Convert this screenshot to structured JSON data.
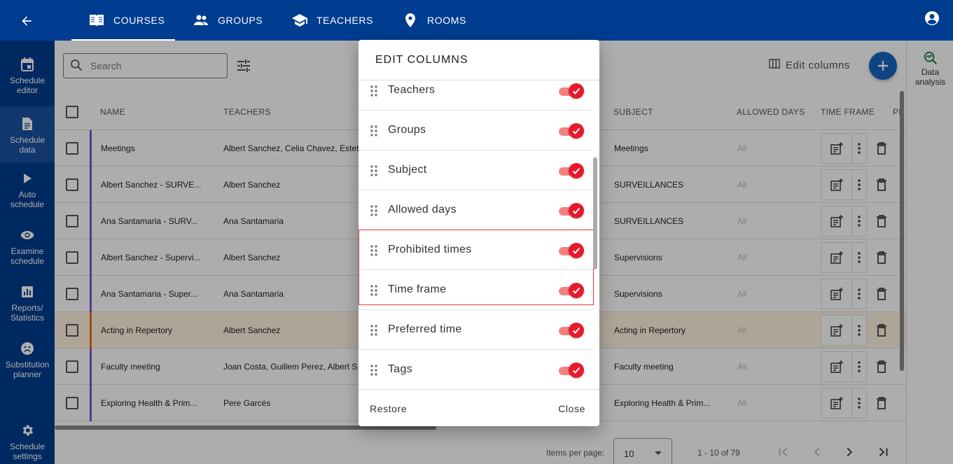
{
  "topbar": {
    "tabs": [
      {
        "label": "COURSES",
        "icon": "book-icon"
      },
      {
        "label": "GROUPS",
        "icon": "people-icon"
      },
      {
        "label": "TEACHERS",
        "icon": "school-icon"
      },
      {
        "label": "ROOMS",
        "icon": "location-pin-icon"
      }
    ],
    "active_tab": "COURSES"
  },
  "sidebar": {
    "items": [
      {
        "label": "Schedule editor",
        "line1": "Schedule",
        "line2": "editor"
      },
      {
        "label": "Schedule data",
        "line1": "Schedule",
        "line2": "data",
        "active": true
      },
      {
        "label": "Auto schedule",
        "line1": "Auto",
        "line2": "schedule"
      },
      {
        "label": "Examine schedule",
        "line1": "Examine",
        "line2": "schedule"
      },
      {
        "label": "Reports/ Statistics",
        "line1": "Reports/",
        "line2": "Statistics"
      },
      {
        "label": "Substitution planner",
        "line1": "Substitution",
        "line2": "planner"
      },
      {
        "label": "Schedule settings",
        "line1": "Schedule",
        "line2": "settings"
      }
    ]
  },
  "toolbar": {
    "search_placeholder": "Search",
    "edit_columns_label": "Edit columns"
  },
  "table": {
    "headers": {
      "name": "NAME",
      "teachers": "TEACHERS",
      "subject": "SUBJECT",
      "allowed_days": "ALLOWED DAYS",
      "time_frame": "TIME FRAME",
      "pr": "PI"
    },
    "rows": [
      {
        "name": "Meetings",
        "teachers": "Albert Sanchez, Celia Chavez, Estet",
        "subject": "Meetings",
        "allowed_days": "All"
      },
      {
        "name": "Albert Sanchez - SURVE...",
        "teachers": "Albert Sanchez",
        "subject": "SURVEILLANCES",
        "allowed_days": "All"
      },
      {
        "name": "Ana Santamaria - SURV...",
        "teachers": "Ana Santamaria",
        "subject": "SURVEILLANCES",
        "allowed_days": "All"
      },
      {
        "name": "Albert Sanchez - Supervi...",
        "teachers": "Albert Sanchez",
        "subject": "Supervisions",
        "allowed_days": "All"
      },
      {
        "name": "Ana Santamaria - Super...",
        "teachers": "Ana Santamaria",
        "subject": "Supervisions",
        "allowed_days": "All"
      },
      {
        "name": "Acting in Repertory",
        "teachers": "Albert Sanchez",
        "subject": "Acting in Repertory",
        "allowed_days": "All",
        "highlight": true
      },
      {
        "name": "Faculty meeting",
        "teachers": "Joan Costa, Guillem Perez, Albert S",
        "subject": "Faculty meeting",
        "allowed_days": "All"
      },
      {
        "name": "Exploring Health & Prim...",
        "teachers": "Pere Garcés",
        "subject": "Exploring Health & Prim...",
        "allowed_days": "All"
      }
    ]
  },
  "pagination": {
    "items_per_page_label": "Items per page:",
    "items_per_page_value": "10",
    "range_label": "1 - 10 of 79"
  },
  "right_panel": {
    "line1": "Data",
    "line2": "analysis"
  },
  "dialog": {
    "title": "EDIT COLUMNS",
    "columns": [
      {
        "label": "Teachers",
        "checked": true
      },
      {
        "label": "Groups",
        "checked": true
      },
      {
        "label": "Subject",
        "checked": true
      },
      {
        "label": "Allowed days",
        "checked": true
      },
      {
        "label": "Prohibited times",
        "checked": true
      },
      {
        "label": "Time frame",
        "checked": true
      },
      {
        "label": "Preferred time",
        "checked": true
      },
      {
        "label": "Tags",
        "checked": true
      }
    ],
    "restore_label": "Restore",
    "close_label": "Close"
  },
  "colors": {
    "primary": "#003c8f",
    "accent": "#e8192c",
    "row_bar": "#7e57c2",
    "highlight_bar": "#ef6c00"
  }
}
